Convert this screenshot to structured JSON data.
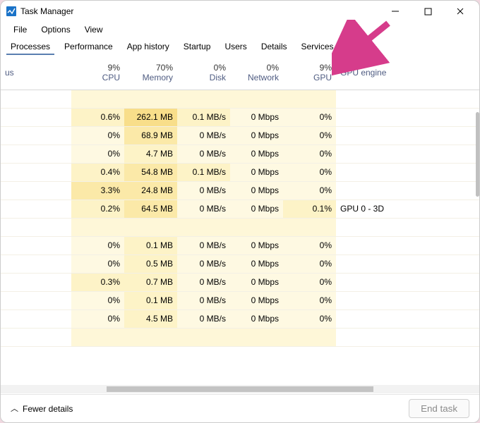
{
  "window": {
    "title": "Task Manager"
  },
  "menu": {
    "file": "File",
    "options": "Options",
    "view": "View"
  },
  "tabs": {
    "processes": "Processes",
    "performance": "Performance",
    "app_history": "App history",
    "startup": "Startup",
    "users": "Users",
    "details": "Details",
    "services": "Services"
  },
  "columns": {
    "status": "us",
    "cpu_pct": "9%",
    "cpu": "CPU",
    "mem_pct": "70%",
    "mem": "Memory",
    "disk_pct": "0%",
    "disk": "Disk",
    "net_pct": "0%",
    "net": "Network",
    "gpu_pct": "9%",
    "gpu": "GPU",
    "gpu_engine": "GPU engine"
  },
  "rows": [
    {
      "cpu": "0.6%",
      "mem": "262.1 MB",
      "disk": "0.1 MB/s",
      "net": "0 Mbps",
      "gpu": "0%",
      "eng": ""
    },
    {
      "cpu": "0%",
      "mem": "68.9 MB",
      "disk": "0 MB/s",
      "net": "0 Mbps",
      "gpu": "0%",
      "eng": ""
    },
    {
      "cpu": "0%",
      "mem": "4.7 MB",
      "disk": "0 MB/s",
      "net": "0 Mbps",
      "gpu": "0%",
      "eng": ""
    },
    {
      "cpu": "0.4%",
      "mem": "54.8 MB",
      "disk": "0.1 MB/s",
      "net": "0 Mbps",
      "gpu": "0%",
      "eng": ""
    },
    {
      "cpu": "3.3%",
      "mem": "24.8 MB",
      "disk": "0 MB/s",
      "net": "0 Mbps",
      "gpu": "0%",
      "eng": ""
    },
    {
      "cpu": "0.2%",
      "mem": "64.5 MB",
      "disk": "0 MB/s",
      "net": "0 Mbps",
      "gpu": "0.1%",
      "eng": "GPU 0 - 3D"
    },
    {
      "cpu": "0%",
      "mem": "0.1 MB",
      "disk": "0 MB/s",
      "net": "0 Mbps",
      "gpu": "0%",
      "eng": ""
    },
    {
      "cpu": "0%",
      "mem": "0.5 MB",
      "disk": "0 MB/s",
      "net": "0 Mbps",
      "gpu": "0%",
      "eng": ""
    },
    {
      "cpu": "0.3%",
      "mem": "0.7 MB",
      "disk": "0 MB/s",
      "net": "0 Mbps",
      "gpu": "0%",
      "eng": ""
    },
    {
      "cpu": "0%",
      "mem": "0.1 MB",
      "disk": "0 MB/s",
      "net": "0 Mbps",
      "gpu": "0%",
      "eng": ""
    },
    {
      "cpu": "0%",
      "mem": "4.5 MB",
      "disk": "0 MB/s",
      "net": "0 Mbps",
      "gpu": "0%",
      "eng": ""
    }
  ],
  "footer": {
    "fewer": "Fewer details",
    "end_task": "End task"
  },
  "icon_colors": {
    "tm": "#1a73c8"
  },
  "arrow_color": "#d63c8b"
}
